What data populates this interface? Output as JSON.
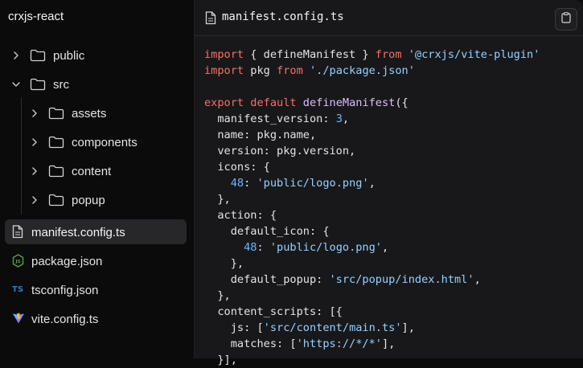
{
  "sidebar": {
    "project": "crxjs-react",
    "items": [
      {
        "label": "public",
        "type": "folder",
        "depth": 0,
        "expanded": false
      },
      {
        "label": "src",
        "type": "folder",
        "depth": 0,
        "expanded": true
      },
      {
        "label": "assets",
        "type": "folder",
        "depth": 1,
        "expanded": false
      },
      {
        "label": "components",
        "type": "folder",
        "depth": 1,
        "expanded": false
      },
      {
        "label": "content",
        "type": "folder",
        "depth": 1,
        "expanded": false
      },
      {
        "label": "popup",
        "type": "folder",
        "depth": 1,
        "expanded": false
      },
      {
        "label": "manifest.config.ts",
        "type": "file",
        "icon": "file-icon",
        "selected": true
      },
      {
        "label": "package.json",
        "type": "file",
        "icon": "nodejs-icon"
      },
      {
        "label": "tsconfig.json",
        "type": "file",
        "icon": "typescript-icon"
      },
      {
        "label": "vite.config.ts",
        "type": "file",
        "icon": "vite-icon"
      }
    ]
  },
  "editor": {
    "filename": "manifest.config.ts",
    "code": [
      [
        [
          "kw",
          "import"
        ],
        [
          "pl",
          " { defineManifest } "
        ],
        [
          "kw",
          "from"
        ],
        [
          "pl",
          " "
        ],
        [
          "str",
          "'@crxjs/vite-plugin'"
        ]
      ],
      [
        [
          "kw",
          "import"
        ],
        [
          "pl",
          " pkg "
        ],
        [
          "kw",
          "from"
        ],
        [
          "pl",
          " "
        ],
        [
          "str",
          "'./package.json'"
        ]
      ],
      [],
      [
        [
          "kw",
          "export"
        ],
        [
          "pl",
          " "
        ],
        [
          "kw",
          "default"
        ],
        [
          "pl",
          " "
        ],
        [
          "fn",
          "defineManifest"
        ],
        [
          "pl",
          "({"
        ]
      ],
      [
        [
          "pl",
          "  manifest_version: "
        ],
        [
          "num",
          "3"
        ],
        [
          "pl",
          ","
        ]
      ],
      [
        [
          "pl",
          "  name: pkg.name,"
        ]
      ],
      [
        [
          "pl",
          "  version: pkg.version,"
        ]
      ],
      [
        [
          "pl",
          "  icons: {"
        ]
      ],
      [
        [
          "pl",
          "    "
        ],
        [
          "num",
          "48"
        ],
        [
          "pl",
          ": "
        ],
        [
          "str",
          "'public/logo.png'"
        ],
        [
          "pl",
          ","
        ]
      ],
      [
        [
          "pl",
          "  },"
        ]
      ],
      [
        [
          "pl",
          "  action: {"
        ]
      ],
      [
        [
          "pl",
          "    default_icon: {"
        ]
      ],
      [
        [
          "pl",
          "      "
        ],
        [
          "num",
          "48"
        ],
        [
          "pl",
          ": "
        ],
        [
          "str",
          "'public/logo.png'"
        ],
        [
          "pl",
          ","
        ]
      ],
      [
        [
          "pl",
          "    },"
        ]
      ],
      [
        [
          "pl",
          "    default_popup: "
        ],
        [
          "str",
          "'src/popup/index.html'"
        ],
        [
          "pl",
          ","
        ]
      ],
      [
        [
          "pl",
          "  },"
        ]
      ],
      [
        [
          "pl",
          "  content_scripts: [{"
        ]
      ],
      [
        [
          "pl",
          "    js: ["
        ],
        [
          "str",
          "'src/content/main.ts'"
        ],
        [
          "pl",
          "],"
        ]
      ],
      [
        [
          "pl",
          "    matches: ["
        ],
        [
          "str",
          "'https://*/*'"
        ],
        [
          "pl",
          "],"
        ]
      ],
      [
        [
          "pl",
          "  }],"
        ]
      ]
    ]
  }
}
